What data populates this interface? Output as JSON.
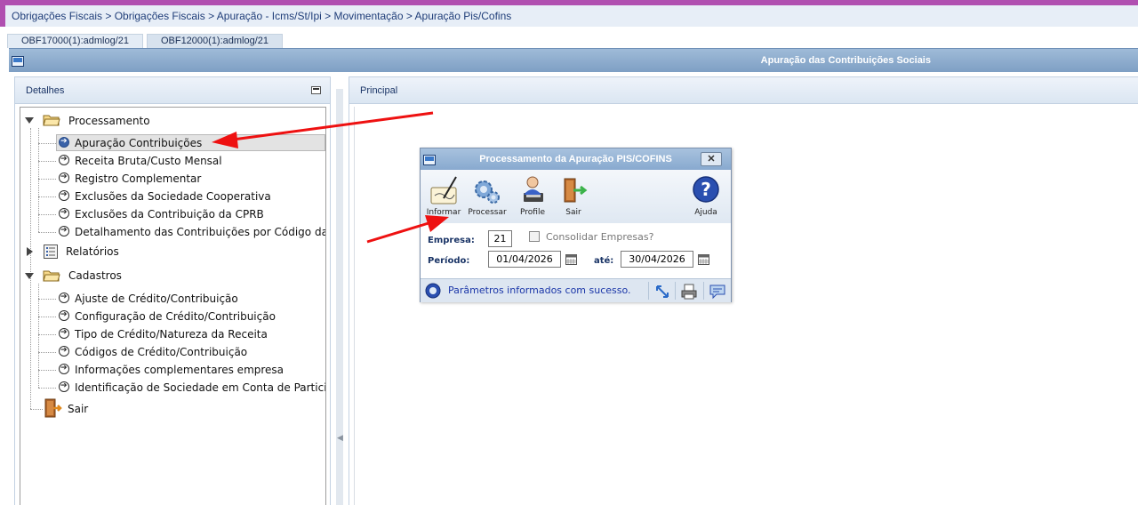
{
  "breadcrumb": "Obrigações Fiscais > Obrigações Fiscais > Apuração - Icms/St/Ipi > Movimentação > Apuração Pis/Cofins",
  "tabs": [
    {
      "label": "OBF17000(1):admlog/21"
    },
    {
      "label": "OBF12000(1):admlog/21"
    }
  ],
  "main_window": {
    "title": "Apuração das Contribuições Sociais"
  },
  "left_panel": {
    "title": "Detalhes",
    "tree": {
      "processamento": {
        "label": "Processamento",
        "items": [
          "Apuração Contribuições",
          "Receita Bruta/Custo Mensal",
          "Registro Complementar",
          "Exclusões da Sociedade Cooperativa",
          "Exclusões da Contribuição da CPRB",
          "Detalhamento das Contribuições por Código da Recei"
        ]
      },
      "relatorios": {
        "label": "Relatórios"
      },
      "cadastros": {
        "label": "Cadastros",
        "items": [
          "Ajuste de Crédito/Contribuição",
          "Configuração de Crédito/Contribuição",
          "Tipo de Crédito/Natureza da Receita",
          "Códigos de Crédito/Contribuição",
          "Informações complementares empresa",
          "Identificação de Sociedade em Conta de Participação"
        ]
      },
      "sair": {
        "label": "Sair"
      }
    }
  },
  "right_panel": {
    "title": "Principal"
  },
  "dialog": {
    "title": "Processamento da Apuração PIS/COFINS",
    "close_label": "✕",
    "toolbar": {
      "informar": "Informar",
      "processar": "Processar",
      "profile": "Profile",
      "sair": "Sair",
      "ajuda": "Ajuda"
    },
    "form": {
      "empresa_label": "Empresa:",
      "empresa_value": "21",
      "consolidar_label": "Consolidar Empresas?",
      "periodo_label": "Período:",
      "periodo_inicio": "01/04/2026",
      "ate_label": "até:",
      "periodo_fim": "30/04/2026"
    },
    "status_message": "Parâmetros informados com sucesso."
  },
  "colors": {
    "accent_bar": "#b04fb0",
    "title_bar": "#88a9cf",
    "breadcrumb_text": "#1f3d78",
    "status_text": "#1a36a8",
    "annotation_arrow": "#ee1111"
  }
}
